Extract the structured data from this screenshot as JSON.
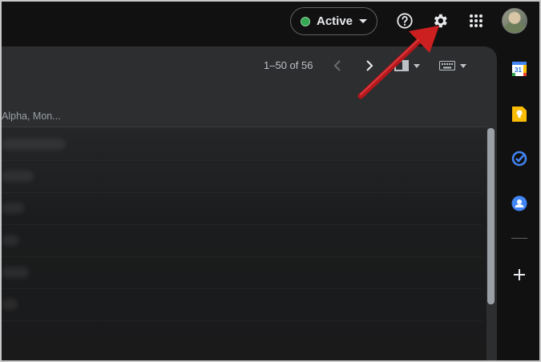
{
  "topbar": {
    "status": {
      "label": "Active",
      "color": "#34a853"
    },
    "icons": {
      "help": "help-icon",
      "settings": "gear-icon",
      "apps": "apps-grid-icon",
      "account": "avatar"
    }
  },
  "toolbar": {
    "page_range": "1–50 of 56",
    "prev": "chevron-left-icon",
    "next": "chevron-right-icon",
    "split_pane": "split-pane-icon",
    "input_tools": "keyboard-icon"
  },
  "message_list": {
    "preview_text": "Alpha, Mon...",
    "rows": 6
  },
  "side_panel": {
    "apps": [
      "calendar-icon",
      "keep-icon",
      "tasks-icon",
      "contacts-icon"
    ],
    "add": "plus-icon",
    "calendar_day": "31"
  },
  "annotation": {
    "color": "#cc1f1f",
    "target": "settings"
  }
}
